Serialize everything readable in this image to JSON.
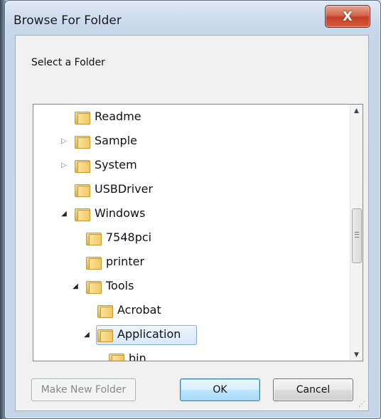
{
  "window": {
    "title": "Browse For Folder",
    "close_label": "X"
  },
  "caption": "Select a Folder",
  "tree": [
    {
      "label": "Readme",
      "arrow": "",
      "indent": 0
    },
    {
      "label": "Sample",
      "arrow": "collapsed",
      "indent": 0
    },
    {
      "label": "System",
      "arrow": "collapsed",
      "indent": 0
    },
    {
      "label": "USBDriver",
      "arrow": "",
      "indent": 0
    },
    {
      "label": "Windows",
      "arrow": "expanded",
      "indent": 0
    },
    {
      "label": "7548pci",
      "arrow": "",
      "indent": 1
    },
    {
      "label": "printer",
      "arrow": "",
      "indent": 1
    },
    {
      "label": "Tools",
      "arrow": "expanded",
      "indent": 1
    },
    {
      "label": "Acrobat",
      "arrow": "",
      "indent": 2
    },
    {
      "label": "Application",
      "arrow": "expanded",
      "indent": 2,
      "selected": true
    },
    {
      "label": "bin",
      "arrow": "",
      "indent": 3
    }
  ],
  "buttons": {
    "make_new_folder": "Make New Folder",
    "ok": "OK",
    "cancel": "Cancel"
  },
  "colors": {
    "selection": "#d7e8fb",
    "close_button": "#c33f25",
    "default_button": "#3c7fb1"
  }
}
